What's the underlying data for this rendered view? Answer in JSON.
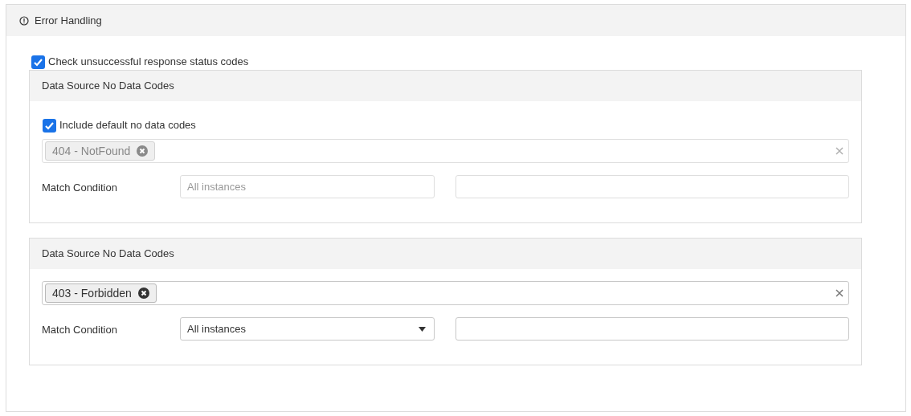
{
  "panel": {
    "title": "Error Handling"
  },
  "check_status": {
    "label": "Check unsuccessful response status codes",
    "checked": true
  },
  "groups": [
    {
      "title": "Data Source No Data Codes",
      "disabled": true,
      "include_default": {
        "label": "Include default no data codes",
        "checked": true
      },
      "tags": [
        "404 - NotFound"
      ],
      "match_label": "Match Condition",
      "match_select": {
        "value": "All instances"
      }
    },
    {
      "title": "Data Source No Data Codes",
      "disabled": false,
      "tags": [
        "403 - Forbidden"
      ],
      "match_label": "Match Condition",
      "match_select": {
        "value": "All instances"
      }
    }
  ]
}
